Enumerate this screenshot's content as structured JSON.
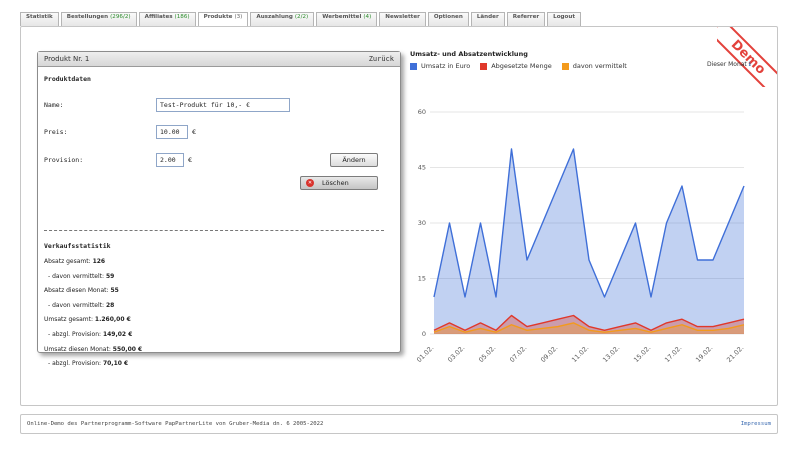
{
  "tabs": [
    {
      "label": "Statistik",
      "count": ""
    },
    {
      "label": "Bestellungen",
      "count": "(296/2)"
    },
    {
      "label": "Affiliates",
      "count": "(186)"
    },
    {
      "label": "Produkte",
      "count": "(3)"
    },
    {
      "label": "Auszahlung",
      "count": "(2/2)"
    },
    {
      "label": "Werbemittel",
      "count": "(4)"
    },
    {
      "label": "Newsletter",
      "count": ""
    },
    {
      "label": "Optionen",
      "count": ""
    },
    {
      "label": "Länder",
      "count": ""
    },
    {
      "label": "Referrer",
      "count": ""
    },
    {
      "label": "Logout",
      "count": ""
    }
  ],
  "active_tab": 3,
  "demo_badge": "Demo",
  "product": {
    "header_title": "Produkt Nr. 1",
    "back_link": "Zurück",
    "section_title": "Produktdaten",
    "name_label": "Name:",
    "name_value": "Test-Produkt für 10,- €",
    "price_label": "Preis:",
    "price_value": "10.00",
    "price_unit": "€",
    "commission_label": "Provision:",
    "commission_value": "2.00",
    "commission_unit": "€",
    "change_button": "Ändern",
    "delete_button": "Löschen",
    "stats_title": "Verkaufsstatistik",
    "stats": [
      {
        "label": "Absatz gesamt:",
        "value": "126"
      },
      {
        "label": "- davon vermittelt:",
        "value": "59"
      },
      {
        "label": "Absatz diesen Monat:",
        "value": "55"
      },
      {
        "label": "- davon vermittelt:",
        "value": "28"
      },
      {
        "label": "Umsatz gesamt:",
        "value": "1.260,00 €"
      },
      {
        "label": "- abzgl. Provision:",
        "value": "149,02 €"
      },
      {
        "label": "Umsatz diesen Monat:",
        "value": "550,00 €"
      },
      {
        "label": "- abzgl. Provision:",
        "value": "70,10 €"
      }
    ]
  },
  "month_selector": {
    "label": "Dieser Monat",
    "icon": "info-icon"
  },
  "chart_data": {
    "type": "area",
    "title": "Umsatz- und Absatzentwicklung",
    "x": [
      "01.02.",
      "02.02.",
      "03.02.",
      "04.02.",
      "05.02.",
      "06.02.",
      "07.02.",
      "08.02.",
      "09.02.",
      "10.02.",
      "11.02.",
      "12.02.",
      "13.02.",
      "14.02.",
      "15.02.",
      "16.02.",
      "17.02.",
      "18.02.",
      "19.02.",
      "20.02.",
      "21.02."
    ],
    "xticklabels": [
      "01.02.",
      "03.02.",
      "05.02.",
      "07.02.",
      "09.02.",
      "11.02.",
      "13.02.",
      "15.02.",
      "17.02.",
      "19.02.",
      "21.02."
    ],
    "yticks": [
      0,
      15,
      30,
      45,
      60
    ],
    "ylim": [
      0,
      60
    ],
    "grid": true,
    "legend_position": "top",
    "series": [
      {
        "name": "Umsatz in Euro",
        "color": "#3f6fd8",
        "values": [
          10,
          30,
          10,
          30,
          10,
          50,
          20,
          30,
          40,
          50,
          20,
          10,
          20,
          30,
          10,
          30,
          40,
          20,
          20,
          30,
          40
        ]
      },
      {
        "name": "Abgesetzte Menge",
        "color": "#e0382b",
        "values": [
          1,
          3,
          1,
          3,
          1,
          5,
          2,
          3,
          4,
          5,
          2,
          1,
          2,
          3,
          1,
          3,
          4,
          2,
          2,
          3,
          4
        ]
      },
      {
        "name": "davon vermittelt",
        "color": "#f39a1c",
        "values": [
          0.5,
          2,
          0.5,
          1.5,
          0.5,
          2.5,
          1,
          1.5,
          2,
          3,
          1,
          0.5,
          1,
          1.5,
          0.5,
          1.5,
          2.5,
          1,
          1,
          1.5,
          2.5
        ]
      }
    ]
  },
  "footer": {
    "text": "Online-Demo des Partnerprogramm-Software PapPartnerLite von Gruber-Media dn. 6 2005-2022",
    "imprint": "Impressum"
  }
}
